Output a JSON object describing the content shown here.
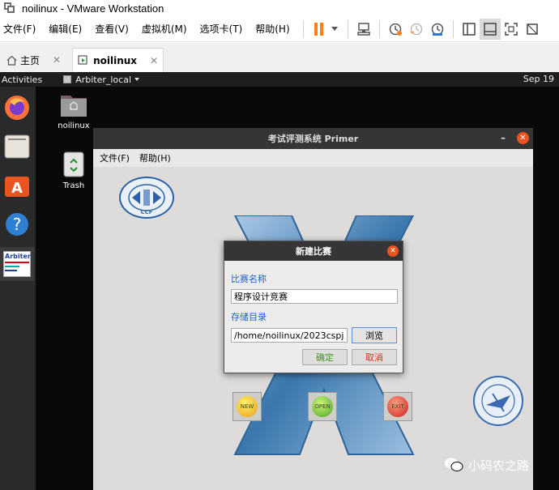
{
  "window": {
    "title": "noilinux - VMware Workstation"
  },
  "menu": {
    "items": [
      "文件(F)",
      "编辑(E)",
      "查看(V)",
      "虚拟机(M)",
      "选项卡(T)",
      "帮助(H)"
    ]
  },
  "tabs": [
    {
      "label": "主页",
      "active": false
    },
    {
      "label": "noilinux",
      "active": true
    }
  ],
  "guest": {
    "top_panel": {
      "activities": "Activities",
      "app_menu": "Arbiter_local",
      "clock": "Sep 19"
    },
    "dock": {
      "arbiter_label": "Arbiter"
    },
    "desktop_icons": [
      {
        "label": "noilinux"
      },
      {
        "label": "Trash"
      }
    ]
  },
  "primer": {
    "title": "考试评测系统 Primer",
    "menu": [
      "文件(F)",
      "帮助(H)"
    ],
    "buttons": [
      "NEW",
      "OPEN",
      "EXIT"
    ],
    "logo_text": "CCF"
  },
  "dialog": {
    "title": "新建比赛",
    "name_label": "比赛名称",
    "name_value": "程序设计竞赛",
    "dir_label": "存储目录",
    "dir_value": "/home/noilinux/2023cspj",
    "browse": "浏览",
    "ok": "确定",
    "cancel": "取消"
  },
  "watermark": {
    "text": "小码农之路"
  },
  "colors": {
    "accent_orange": "#e95420",
    "pause_orange": "#ff7e1d",
    "link_blue": "#1f5fcf",
    "ok_green": "#3a9a1a",
    "cancel_red": "#d4341a"
  }
}
